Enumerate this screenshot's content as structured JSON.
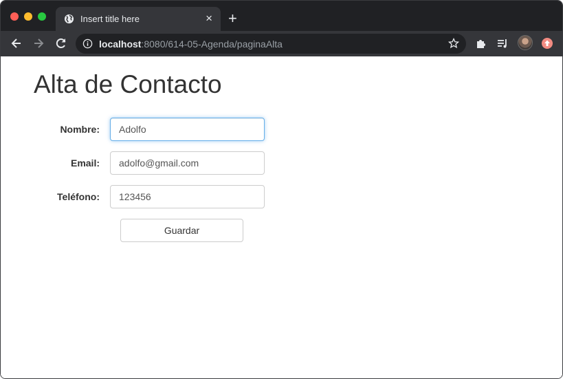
{
  "browser": {
    "tab_title": "Insert title here",
    "tab_close": "×",
    "new_tab": "+",
    "url_host": "localhost",
    "url_path": ":8080/614-05-Agenda/paginaAlta"
  },
  "icons": {
    "back": "arrow-left-icon",
    "forward": "arrow-right-icon",
    "reload": "reload-icon",
    "info": "info-icon",
    "bookmark": "star-icon",
    "extensions": "puzzle-icon",
    "media": "playlist-icon",
    "profile": "avatar",
    "update": "update-icon"
  },
  "page": {
    "title": "Alta de Contacto",
    "fields": {
      "nombre_label": "Nombre:",
      "nombre_value": "Adolfo",
      "email_label": "Email:",
      "email_value": "adolfo@gmail.com",
      "telefono_label": "Teléfono:",
      "telefono_value": "123456"
    },
    "save_label": "Guardar"
  },
  "colors": {
    "focus_border": "#66afe9",
    "chrome_dark": "#202124",
    "chrome_tab": "#35363a"
  }
}
